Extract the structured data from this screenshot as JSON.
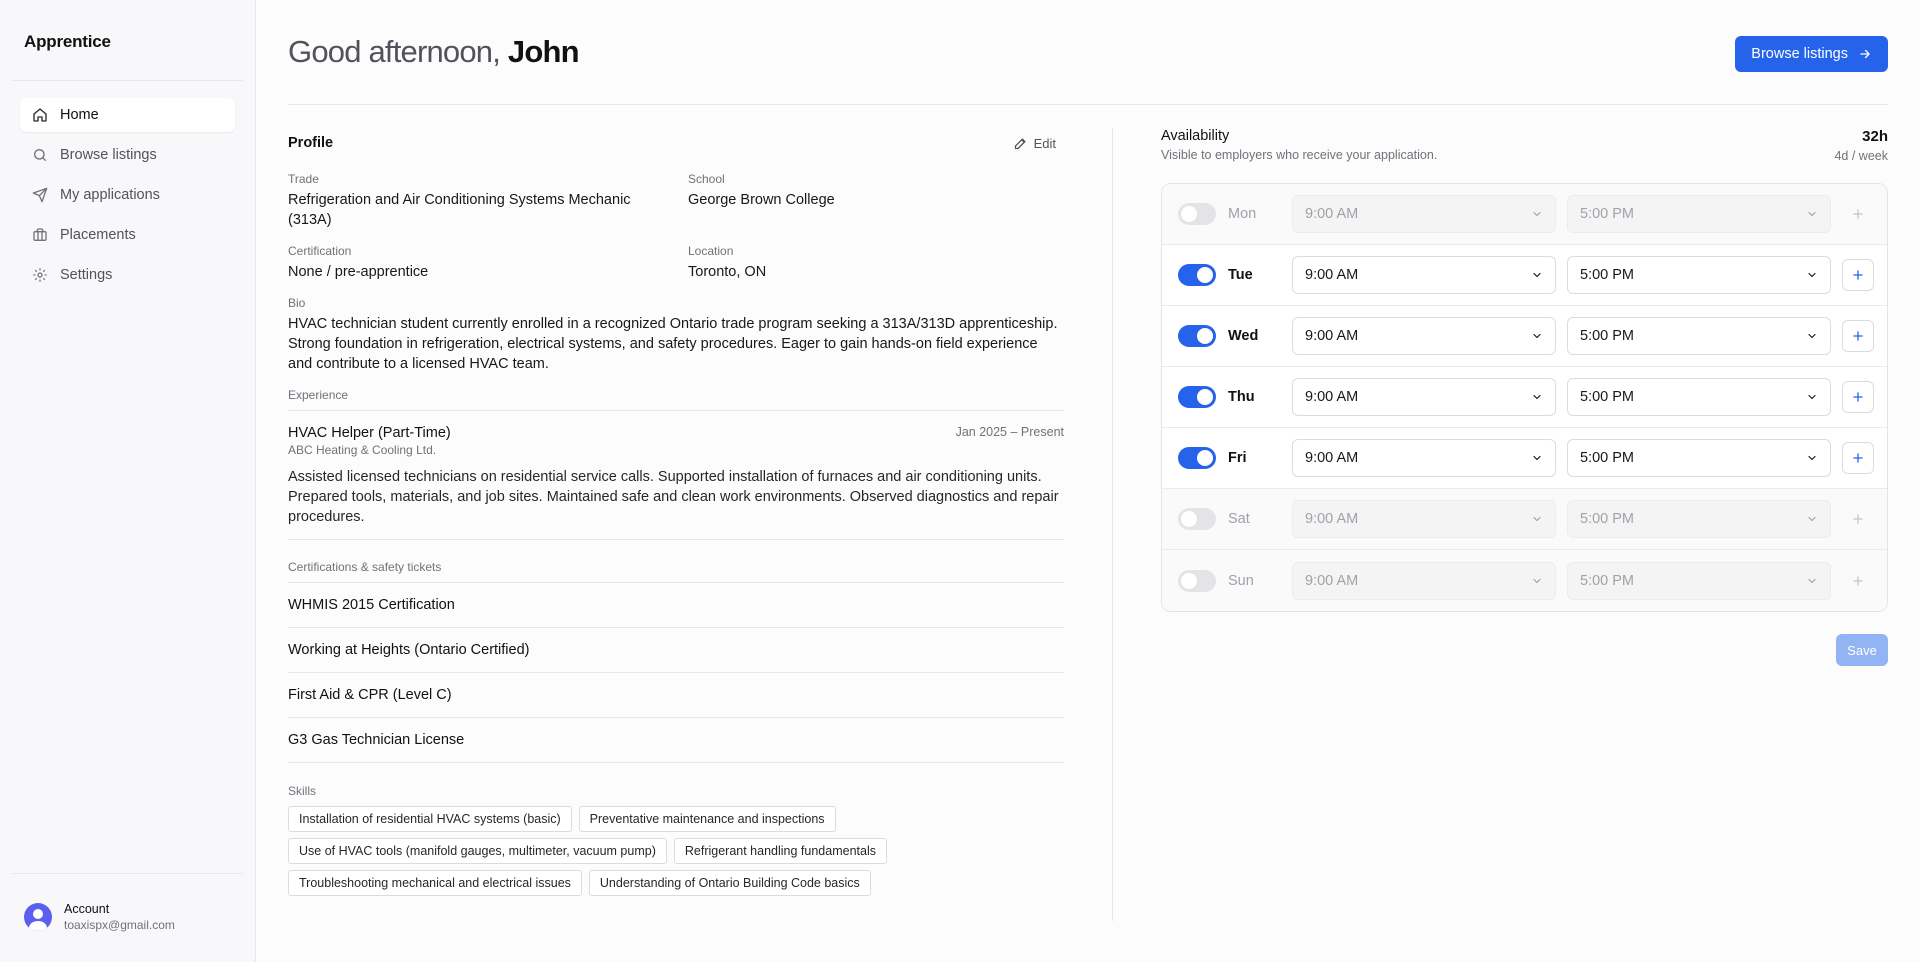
{
  "app": {
    "name": "Apprentice"
  },
  "nav": [
    {
      "label": "Home",
      "icon": "home-icon",
      "active": true
    },
    {
      "label": "Browse listings",
      "icon": "search-icon",
      "active": false
    },
    {
      "label": "My applications",
      "icon": "send-icon",
      "active": false
    },
    {
      "label": "Placements",
      "icon": "briefcase-icon",
      "active": false
    },
    {
      "label": "Settings",
      "icon": "gear-icon",
      "active": false
    }
  ],
  "account": {
    "label": "Account",
    "email": "toaxispx@gmail.com"
  },
  "header": {
    "greeting": "Good afternoon,",
    "name": "John",
    "browse_label": "Browse listings"
  },
  "profile": {
    "title": "Profile",
    "edit_label": "Edit",
    "trade_label": "Trade",
    "trade": "Refrigeration and Air Conditioning Systems Mechanic (313A)",
    "school_label": "School",
    "school": "George Brown College",
    "certification_label": "Certification",
    "certification": "None / pre-apprentice",
    "location_label": "Location",
    "location": "Toronto, ON",
    "bio_label": "Bio",
    "bio": "HVAC technician student currently enrolled in a recognized Ontario trade program seeking a 313A/313D apprenticeship. Strong foundation in refrigeration, electrical systems, and safety procedures. Eager to gain hands-on field experience and contribute to a licensed HVAC team.",
    "experience_label": "Experience",
    "experience": {
      "title": "HVAC Helper (Part-Time)",
      "company": "ABC Heating & Cooling Ltd.",
      "dates": "Jan 2025 – Present",
      "description": "Assisted licensed technicians on residential service calls. Supported installation of furnaces and air conditioning units. Prepared tools, materials, and job sites. Maintained safe and clean work environments. Observed diagnostics and repair procedures."
    },
    "certs_label": "Certifications & safety tickets",
    "certs": [
      "WHMIS 2015 Certification",
      "Working at Heights (Ontario Certified)",
      "First Aid & CPR (Level C)",
      "G3 Gas Technician License"
    ],
    "skills_label": "Skills",
    "skills": [
      "Installation of residential HVAC systems (basic)",
      "Preventative maintenance and inspections",
      "Use of HVAC tools (manifold gauges, multimeter, vacuum pump)",
      "Refrigerant handling fundamentals",
      "Troubleshooting mechanical and electrical issues",
      "Understanding of Ontario Building Code basics"
    ]
  },
  "availability": {
    "title": "Availability",
    "subtitle": "Visible to employers who receive your application.",
    "hours": "32h",
    "summary": "4d / week",
    "days": [
      {
        "day": "Mon",
        "enabled": false,
        "start": "9:00 AM",
        "end": "5:00 PM"
      },
      {
        "day": "Tue",
        "enabled": true,
        "start": "9:00 AM",
        "end": "5:00 PM"
      },
      {
        "day": "Wed",
        "enabled": true,
        "start": "9:00 AM",
        "end": "5:00 PM"
      },
      {
        "day": "Thu",
        "enabled": true,
        "start": "9:00 AM",
        "end": "5:00 PM"
      },
      {
        "day": "Fri",
        "enabled": true,
        "start": "9:00 AM",
        "end": "5:00 PM"
      },
      {
        "day": "Sat",
        "enabled": false,
        "start": "9:00 AM",
        "end": "5:00 PM"
      },
      {
        "day": "Sun",
        "enabled": false,
        "start": "9:00 AM",
        "end": "5:00 PM"
      }
    ],
    "save_label": "Save"
  },
  "colors": {
    "accent": "#2563eb",
    "save_disabled": "#93b4f3"
  }
}
